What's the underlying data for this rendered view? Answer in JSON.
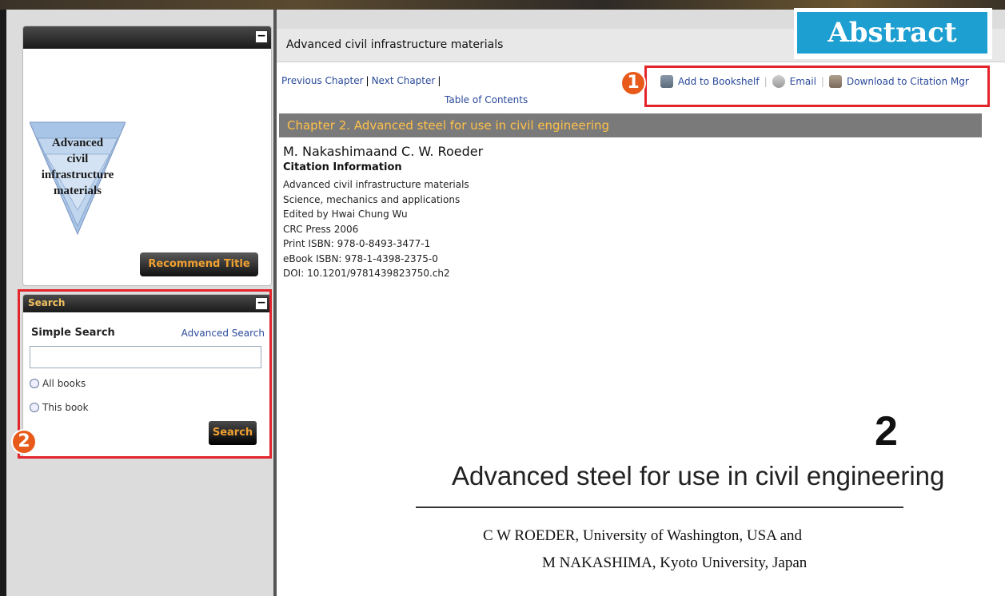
{
  "header": {
    "badge": "Abstract"
  },
  "sidebar": {
    "cover_panel": {
      "cover_text": [
        "Advanced",
        "civil",
        "infrastructure",
        "materials"
      ],
      "recommend_label": "Recommend Title",
      "collapse_label": "−"
    },
    "search_panel": {
      "title": "Search",
      "collapse_label": "−",
      "simple_label": "Simple Search",
      "advanced_link": "Advanced Search",
      "input_value": "",
      "options": [
        "All books",
        "This book"
      ],
      "search_button": "Search"
    }
  },
  "main": {
    "book_title": "Advanced civil infrastructure materials",
    "nav": {
      "previous": "Previous Chapter",
      "next": "Next Chapter",
      "toc": "Table of Contents"
    },
    "actions": {
      "bookshelf": "Add to Bookshelf",
      "email": "Email",
      "citation": "Download to Citation Mgr"
    },
    "chapter_title": "Chapter 2. Advanced steel for use in civil engineering",
    "authors": "M. Nakashimaand C. W. Roeder",
    "citation_heading": "Citation Information",
    "citation_lines": [
      "Advanced civil infrastructure materials",
      "Science, mechanics and applications",
      "Edited by Hwai Chung Wu",
      "CRC Press 2006",
      "Print ISBN: 978-0-8493-3477-1",
      "eBook ISBN: 978-1-4398-2375-0",
      "DOI: 10.1201/9781439823750.ch2"
    ],
    "page_preview": {
      "chapter_number": "2",
      "chapter_name": "Advanced steel for use in civil engineering",
      "author_line_1": "C W ROEDER, University of Washington, USA and",
      "author_line_2": "M NAKASHIMA, Kyoto University, Japan"
    }
  },
  "callouts": [
    "1",
    "2"
  ],
  "colors": {
    "accent_blue": "#1e9fd1",
    "highlight_red": "#e3242b",
    "chapter_orange": "#ffc14a",
    "link_blue": "#2a4a9a"
  }
}
